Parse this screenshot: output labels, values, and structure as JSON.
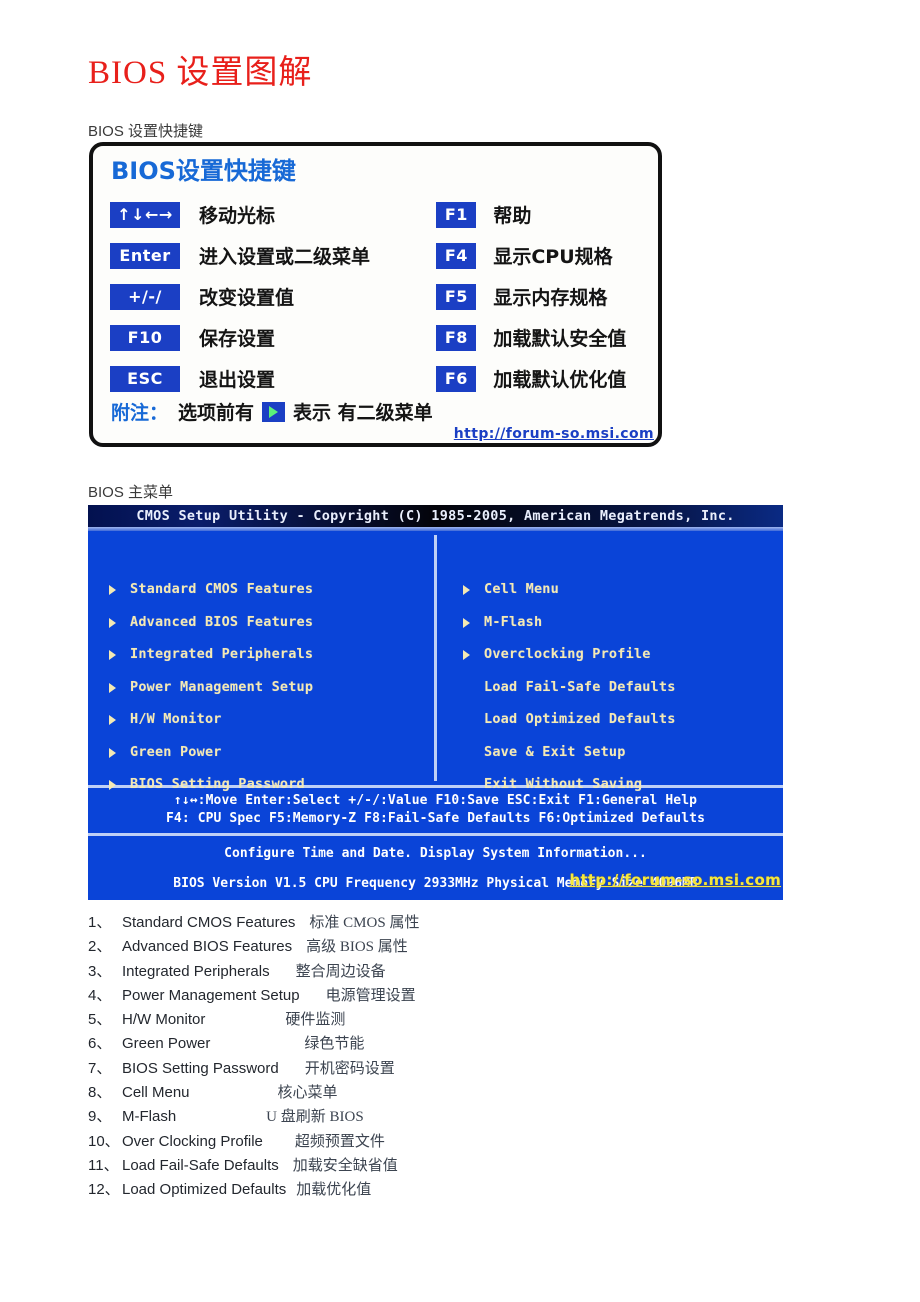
{
  "document": {
    "title": "BIOS 设置图解",
    "section_shortcut_label": "BIOS 设置快捷键",
    "section_mainmenu_label": "BIOS 主菜单"
  },
  "shortcut_card": {
    "title": "BIOS设置快捷键",
    "left_rows": [
      {
        "key": "↑↓←→",
        "desc": "移动光标"
      },
      {
        "key": "Enter",
        "desc": "进入设置或二级菜单"
      },
      {
        "key": "+/-/",
        "desc": "改变设置值"
      },
      {
        "key": "F10",
        "desc": "保存设置"
      },
      {
        "key": "ESC",
        "desc": "退出设置"
      }
    ],
    "right_rows": [
      {
        "key": "F1",
        "desc": "帮助"
      },
      {
        "key": "F4",
        "desc": "显示CPU规格"
      },
      {
        "key": "F5",
        "desc": "显示内存规格"
      },
      {
        "key": "F8",
        "desc": "加载默认安全值"
      },
      {
        "key": "F6",
        "desc": "加载默认优化值"
      }
    ],
    "note_label": "附注：",
    "note_before": "选项前有",
    "note_after": "表示 有二级菜单",
    "note_icon": "play-triangle-icon",
    "watermark": "http://forum-so.msi.com",
    "accent_blue": "#1769d6",
    "key_blue": "#1b3fc4"
  },
  "bios": {
    "titlebar": "CMOS Setup Utility - Copyright (C) 1985-2005, American Megatrends, Inc.",
    "left_items": [
      {
        "label": "Standard CMOS Features",
        "submenu": true
      },
      {
        "label": "Advanced BIOS Features",
        "submenu": true
      },
      {
        "label": "Integrated Peripherals",
        "submenu": true
      },
      {
        "label": "Power Management Setup",
        "submenu": true
      },
      {
        "label": "H/W Monitor",
        "submenu": true
      },
      {
        "label": "Green Power",
        "submenu": true
      },
      {
        "label": "BIOS Setting Password",
        "submenu": true
      }
    ],
    "right_items": [
      {
        "label": "Cell Menu",
        "submenu": true
      },
      {
        "label": "M-Flash",
        "submenu": true
      },
      {
        "label": "Overclocking Profile",
        "submenu": true
      },
      {
        "label": "Load Fail-Safe Defaults",
        "submenu": false
      },
      {
        "label": "Load Optimized Defaults",
        "submenu": false
      },
      {
        "label": "Save & Exit Setup",
        "submenu": false
      },
      {
        "label": "Exit Without Saving",
        "submenu": false
      }
    ],
    "help_line1": "↑↓↔:Move   Enter:Select   +/-/:Value   F10:Save   ESC:Exit   F1:General Help",
    "help_line2": "F4: CPU Spec    F5:Memory-Z    F8:Fail-Safe Defaults    F6:Optimized Defaults",
    "hint_line": "Configure Time and Date.  Display System Information...",
    "sysinfo_line": "BIOS Version V1.5    CPU Frequency 2933MHz Physical Memory Size 4096MB",
    "watermark": "http://forum-so.msi.com",
    "bg_blue": "#0a44d8",
    "text_cream": "#f4e9b4"
  },
  "glossary": [
    {
      "num": "1、",
      "en": "Standard CMOS Features",
      "cn": "标准 CMOS 属性"
    },
    {
      "num": "2、",
      "en": "Advanced BIOS Features",
      "cn": "高级 BIOS 属性"
    },
    {
      "num": "3、",
      "en": "Integrated Peripherals",
      "cn": "整合周边设备"
    },
    {
      "num": "4、",
      "en": "Power Management Setup",
      "cn": "电源管理设置"
    },
    {
      "num": "5、",
      "en": "H/W Monitor",
      "cn": "硬件监测"
    },
    {
      "num": "6、",
      "en": "Green Power",
      "cn": "绿色节能"
    },
    {
      "num": "7、",
      "en": "BIOS Setting Password",
      "cn": "开机密码设置"
    },
    {
      "num": "8、",
      "en": "Cell Menu",
      "cn": "核心菜单"
    },
    {
      "num": "9、",
      "en": "M-Flash",
      "cn": "U 盘刷新 BIOS"
    },
    {
      "num": "10、",
      "en": "Over Clocking Profile",
      "cn": "超频预置文件"
    },
    {
      "num": "11、",
      "en": "Load Fail-Safe Defaults",
      "cn": "加载安全缺省值"
    },
    {
      "num": "12、",
      "en": "Load Optimized Defaults",
      "cn": "加载优化值"
    }
  ]
}
